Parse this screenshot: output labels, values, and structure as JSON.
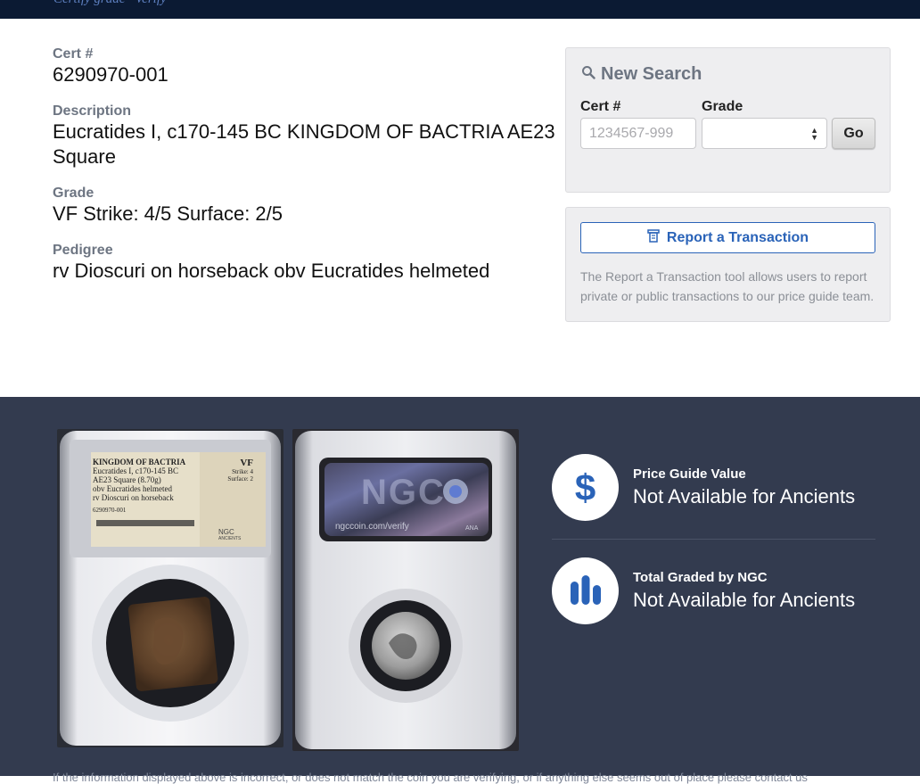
{
  "header": {
    "cut_text": "Certify grade · Verify"
  },
  "cert": {
    "cert_label": "Cert #",
    "cert_value": "6290970-001",
    "description_label": "Description",
    "description_line1": "Eucratides I, c170-145 BC KINGDOM OF BACTRIA AE23",
    "description_line2": "Square",
    "grade_label": "Grade",
    "grade_value": "VF Strike: 4/5 Surface: 2/5",
    "pedigree_label": "Pedigree",
    "pedigree_value": "rv Dioscuri on horseback obv Eucratides helmeted"
  },
  "new_search": {
    "title": "New Search",
    "cert_label": "Cert #",
    "cert_placeholder": "1234567-999",
    "grade_label": "Grade",
    "grade_selected": "",
    "go_label": "Go"
  },
  "report": {
    "button_label": "Report a Transaction",
    "description": "The Report a Transaction tool allows users to report private or public transactions to our price guide team."
  },
  "slab_front": {
    "line1": "KINGDOM OF BACTRIA",
    "line2": "Eucratides I, c170-145 BC",
    "line3": "AE23 Square (8.70g)",
    "line4": "obv Eucratides helmeted",
    "line5": "rv Dioscuri on horseback",
    "serial": "6290970-001",
    "grade": "VF",
    "strike": "Strike: 4",
    "surface": "Surface: 2",
    "brand": "NGC",
    "brand_sub": "ANCIENTS"
  },
  "slab_back": {
    "brand": "NGC",
    "url": "ngccoin.com/verify",
    "badge": "ANA"
  },
  "stats": [
    {
      "title": "Price Guide Value",
      "value": "Not Available for Ancients",
      "icon": "dollar-icon"
    },
    {
      "title": "Total Graded by NGC",
      "value": "Not Available for Ancients",
      "icon": "bar-chart-icon"
    }
  ],
  "footer_text": "If the information displayed above is incorrect, or does not match the coin you are verifying, or if anything else seems out of place please contact us",
  "colors": {
    "navy": "#0b1a33",
    "accent_blue": "#2a63b8",
    "lower_bg": "#333b4f",
    "label_gray": "#6d7582"
  }
}
